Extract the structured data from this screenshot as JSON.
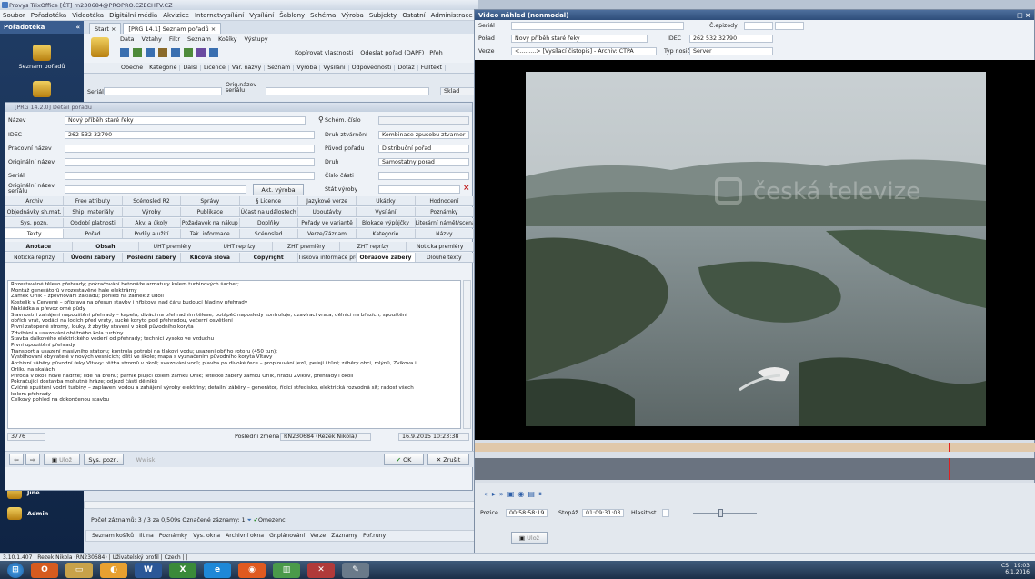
{
  "main_window": {
    "title": "Provys TrixOffice [ČT] rn230684@PROPRO.CZECHTV.CZ",
    "menu": [
      "Soubor",
      "Pořadotéka",
      "Videotéka",
      "Digitální média",
      "Akvizice",
      "Internetvysílání",
      "Vysílání",
      "Šablony",
      "Schéma",
      "Výroba",
      "Subjekty",
      "Ostatní",
      "Administrace"
    ]
  },
  "sidebar": {
    "header": "Pořadotéka",
    "collapse": "«",
    "items": [
      {
        "label": "Seznam pořadů"
      },
      {
        "label": "Jiné"
      },
      {
        "label": "Admin"
      }
    ]
  },
  "tabs": [
    {
      "label": "Start",
      "close": "×"
    },
    {
      "label": "[PRG 14.1] Seznam pořadů",
      "close": "×"
    }
  ],
  "toolbar": {
    "row1": [
      "Data",
      "Vztahy",
      "Filtr",
      "Seznam",
      "Košíky",
      "Výstupy"
    ],
    "row2_tail": [
      "Kopírovat vlastnosti",
      "Odeslat pořad (DAPF)",
      "Přeh"
    ]
  },
  "subtabs": [
    "Obecné",
    "Kategorie",
    "Další",
    "Licence",
    "Var. názvy",
    "Seznam",
    "Výroba",
    "Vysílání",
    "Odpovědnosti",
    "Dotaz",
    "Fulltext"
  ],
  "filter": {
    "serial_label": "Seriál",
    "orig_label": "Orig.název seriálu",
    "sklad": "Sklad"
  },
  "detail": {
    "title": "[PRG 14.2.0] Detail pořadu",
    "fields": {
      "nazev_label": "Název",
      "nazev": "Nový příběh staré řeky",
      "idec_label": "IDEC",
      "idec": "262 532 32790",
      "pracovni_label": "Pracovní název",
      "originalni_label": "Originální název",
      "serial_label": "Seriál",
      "orig_serial_label": "Originální název seriálu",
      "schem_label": "Schém. číslo",
      "druh_zvar_label": "Druh ztvárnění",
      "druh_zvar": "Kombinace zpusobu ztvarner",
      "puvod_label": "Původ pořadu",
      "puvod": "Distribuční pořad",
      "druh_label": "Druh",
      "druh": "Samostatny porad",
      "cislo_casti_label": "Číslo části",
      "akt_vyroba": "Akt. výroba",
      "stat_label": "Stát výroby"
    },
    "tab_rows": [
      [
        {
          "t": "Archiv"
        },
        {
          "t": "Free atributy"
        },
        {
          "t": "Scénosled R2"
        },
        {
          "t": "Správy"
        },
        {
          "t": "§ Licence"
        },
        {
          "t": "Jazykové verze"
        },
        {
          "t": "Ukázky"
        },
        {
          "t": "Hodnocení"
        }
      ],
      [
        {
          "t": "Objednávky sh.mat."
        },
        {
          "t": "Ship. materiály"
        },
        {
          "t": "Výroby"
        },
        {
          "t": "Publikace"
        },
        {
          "t": "Účast na událostech"
        },
        {
          "t": "Upoutávky"
        },
        {
          "t": "Vysílání"
        },
        {
          "t": "Poznámky"
        }
      ],
      [
        {
          "t": "Sys. pozn."
        },
        {
          "t": "Období platnosti"
        },
        {
          "t": "Akv. a úkoly"
        },
        {
          "t": "Požadavek na nákup"
        },
        {
          "t": "Doplňky"
        },
        {
          "t": "Pořady ve variantě"
        },
        {
          "t": "Blokace výpůjčky"
        },
        {
          "t": "Literární námět/scénář"
        }
      ],
      [
        {
          "t": "Texty",
          "hl": true
        },
        {
          "t": "Pořad"
        },
        {
          "t": "Podíly a užití"
        },
        {
          "t": "Tak. informace"
        },
        {
          "t": "Scénosled"
        },
        {
          "t": "Verze/Záznam"
        },
        {
          "t": "Kategorie"
        },
        {
          "t": "Názvy"
        }
      ],
      [
        {
          "t": "Anotace",
          "b": true
        },
        {
          "t": "Obsah",
          "b": true
        },
        {
          "t": "UHT premiéry"
        },
        {
          "t": "UHT reprízy"
        },
        {
          "t": "ZHT premiéry"
        },
        {
          "t": "ZHT reprízy"
        },
        {
          "t": "Noticka premiéry"
        }
      ],
      [
        {
          "t": "Noticka reprízy"
        },
        {
          "t": "Úvodní záběry",
          "b": true
        },
        {
          "t": "Poslední záběry",
          "b": true
        },
        {
          "t": "Klíčová slova",
          "b": true
        },
        {
          "t": "Copyright",
          "b": true
        },
        {
          "t": "Tisková informace pro Internet"
        },
        {
          "t": "Obrazové záběry",
          "b": true,
          "hl": true
        },
        {
          "t": "Dlouhé texty"
        }
      ]
    ],
    "text_lines": [
      "Rozestavěné těleso přehrady; pokračování betonáže armatury kolem turbinových šachet;",
      "Montáž generátorů v rozestavěné hale elektrárny",
      "Zámek Orlík – zpevňování základů; pohled na zámek z údolí",
      "Kostelík v Červené – příprava na přesun stavby i hřbitova nad čáru budoucí hladiny přehrady",
      "Nakládka a převoz orné půdy",
      "Slavnostní zahájení napouštění přehrady – kapela, diváci na přehradním tělese, potápěč naposledy kontroluje, uzavírací vrata, dělníci na březích, spouštění",
      "obřích vrat, vodáci na lodích před vraty, sucké koryto pod přehradou, večerní osvětlení",
      "První zatopené stromy, louky, ž zbytky staveni v okolí původního koryta",
      "Zdvihání a usazování oběžného kola turbíny",
      "Stavba dálkového elektrického vedení od přehrady; technici vysoko ve vzduchu",
      "První upouštění přehrady",
      "Transport a usazení masivního statoru; kontrola potrubí na tlakoví vodu; usazení obřího rotoru (450 tun);",
      "Vystěhovaní obyvatelé v nových vesnicích; děti ve škole; mapa s vyznačením původního koryta Vltavy",
      "Archivní záběry původní řeky Vltavy: těžba stromů v okolí; svazování vorů; plavba po divoké řece – proplouvání jezů, peřejí i tůní; záběry obcí, mlýnů, Zvíkova i",
      "Orlíku na skalách",
      "Příroda v okolí nové nádrže; lidé na břehu; parník plující kolem zámku Orlík; letecké záběry zámku Orlík, hradu Zvíkov, přehrady i okolí",
      "Pokračující dostavba mohutné hráze; odjezd části dělníků",
      "Cvičné spuštění vodní turbíny – zaplavení vodou a zahájení výroby elektřiny; detailní záběry – generátor, řídící středisko, elektrická rozvodná síť; radost všech",
      "kolem přehrady",
      "",
      "Celkový pohled na dokončenou stavbu"
    ],
    "number": "3776",
    "last_change_label": "Poslední změna",
    "last_change_user": "RN230684 (Rezek Nikola)",
    "last_change_date": "16.9.2015 10:23:38",
    "buttons": {
      "uloz": "Ulož",
      "sys_pozn": "Sys. pozn.",
      "wwisk": "Wwisk",
      "ok": "OK",
      "zrusit": "Zrušit"
    }
  },
  "lower": {
    "count_text": "Počet záznamů: 3 / 3 za 0,509s  Označené záznamy: 1",
    "onezenc": "Omezenc",
    "bottom_bar": [
      "Seznam košíků",
      "Ilt na",
      "Poznámky",
      "Vys. okna",
      "Archivní okna",
      "Gr.plánování",
      "Verze",
      "Záznamy",
      "Poř.runy"
    ]
  },
  "statusbar": {
    "text": "3.10.1.407  |  Rezek Nikola (RN230684)  |  Uživatelský profil  |  Czech  |  |"
  },
  "video_window": {
    "title": "Video náhled (nonmodal)",
    "close": "□ ×",
    "serial_label": "Seriál",
    "c_epizody_label": "Č.epizody",
    "porad_label": "Pořad",
    "porad": "Nový příběh staré řeky",
    "idec_label": "IDEC",
    "idec": "262 532 32790",
    "verze_label": "Verze",
    "verze": "<.........> [Vysílací čistopis] - Archiv: CTPA",
    "typ_nosice_label": "Typ nosiče",
    "typ_nosice": "Server",
    "watermark": "česká televize",
    "pozice_label": "Pozice",
    "pozice": "00:58:58:19",
    "stopaz_label": "Stopáž",
    "stopaz": "01:09:31:03",
    "hlasitost_label": "Hlasitost",
    "uloz": "Ulož",
    "timeline_marker": 0.845
  },
  "tray": {
    "lang": "CS",
    "time": "19:03",
    "date": "6.1.2016"
  },
  "colors": {
    "accent": "#2e4d7a",
    "sidebar": "#14305a",
    "timeline": "#e0c8aa",
    "marker": "#e02020"
  }
}
